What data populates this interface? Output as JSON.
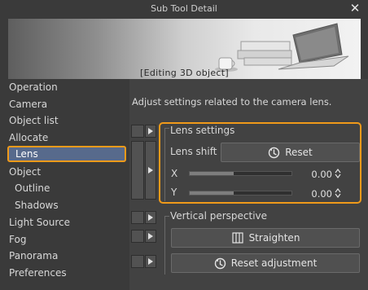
{
  "window": {
    "title": "Sub Tool Detail"
  },
  "banner": {
    "label": "[Editing 3D object]"
  },
  "sidebar": {
    "items": [
      {
        "label": "Operation"
      },
      {
        "label": "Camera"
      },
      {
        "label": "Object list"
      },
      {
        "label": "Allocate"
      },
      {
        "label": "Lens",
        "selected": true
      },
      {
        "label": "Object"
      },
      {
        "label": "Outline",
        "indent": true
      },
      {
        "label": "Shadows",
        "indent": true
      },
      {
        "label": "Light Source"
      },
      {
        "label": "Fog"
      },
      {
        "label": "Panorama"
      },
      {
        "label": "Preferences"
      }
    ]
  },
  "panel": {
    "description": "Adjust settings related to the camera lens.",
    "lens_group": {
      "heading": "Lens settings",
      "lens_shift_label": "Lens shift",
      "reset_label": "Reset",
      "x": {
        "label": "X",
        "value": "0.00",
        "level": 0.43
      },
      "y": {
        "label": "Y",
        "value": "0.00",
        "level": 0.43
      }
    },
    "perspective_group": {
      "heading": "Vertical perspective",
      "straighten_label": "Straighten",
      "reset_adjustment_label": "Reset adjustment"
    }
  },
  "colors": {
    "highlight": "#f09a1a",
    "selection": "#576a8c"
  },
  "icons": [
    "close-icon",
    "reset-icon",
    "straighten-icon",
    "spin-arrows-icon",
    "expand-arrow-icon"
  ]
}
